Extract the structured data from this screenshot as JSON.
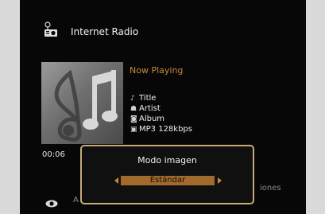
{
  "header": {
    "title": "Internet Radio",
    "icon": "internet-radio-icon"
  },
  "now_playing": {
    "heading": "Now Playing",
    "title": "Title",
    "artist": "Artist",
    "album": "Album",
    "format": "MP3 128kbps",
    "elapsed": "00:06"
  },
  "background": {
    "partial_label": "iones",
    "partial_letter": "A"
  },
  "popup": {
    "title": "Modo imagen",
    "value": "Estándar"
  },
  "colors": {
    "accent": "#c98a3a",
    "popup_border": "#c9a97a",
    "selector_fill": "#a06a2c",
    "screen_bg": "#070707"
  }
}
